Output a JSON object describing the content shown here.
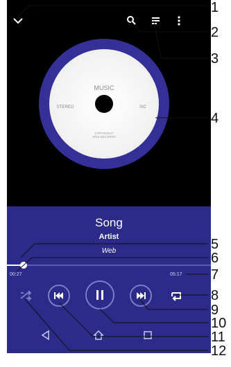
{
  "player": {
    "album": {
      "title": "MUSIC",
      "left_label": "STEREO",
      "right_label": "SIC",
      "small_line1": "COPYRIGHT",
      "small_line2": "2015 RECORDS"
    },
    "song": "Song",
    "artist": "Artist",
    "source": "Web",
    "elapsed": "00:27",
    "duration": "05:17",
    "progress_fraction": 0.08
  },
  "icons": {
    "collapse": "chevron-down-icon",
    "search": "search-icon",
    "queue": "queue-icon",
    "more": "more-vert-icon",
    "shuffle": "shuffle-icon",
    "previous": "previous-track-icon",
    "pause": "pause-icon",
    "next": "next-track-icon",
    "repeat": "repeat-icon",
    "back": "back-icon",
    "home": "home-icon",
    "recents": "recents-icon"
  },
  "callouts": [
    "1",
    "2",
    "3",
    "4",
    "5",
    "6",
    "7",
    "8",
    "9",
    "10",
    "11",
    "12"
  ],
  "colors": {
    "panel": "#2c2b89",
    "disc": "#343097",
    "accent": "#7c7cc8"
  }
}
